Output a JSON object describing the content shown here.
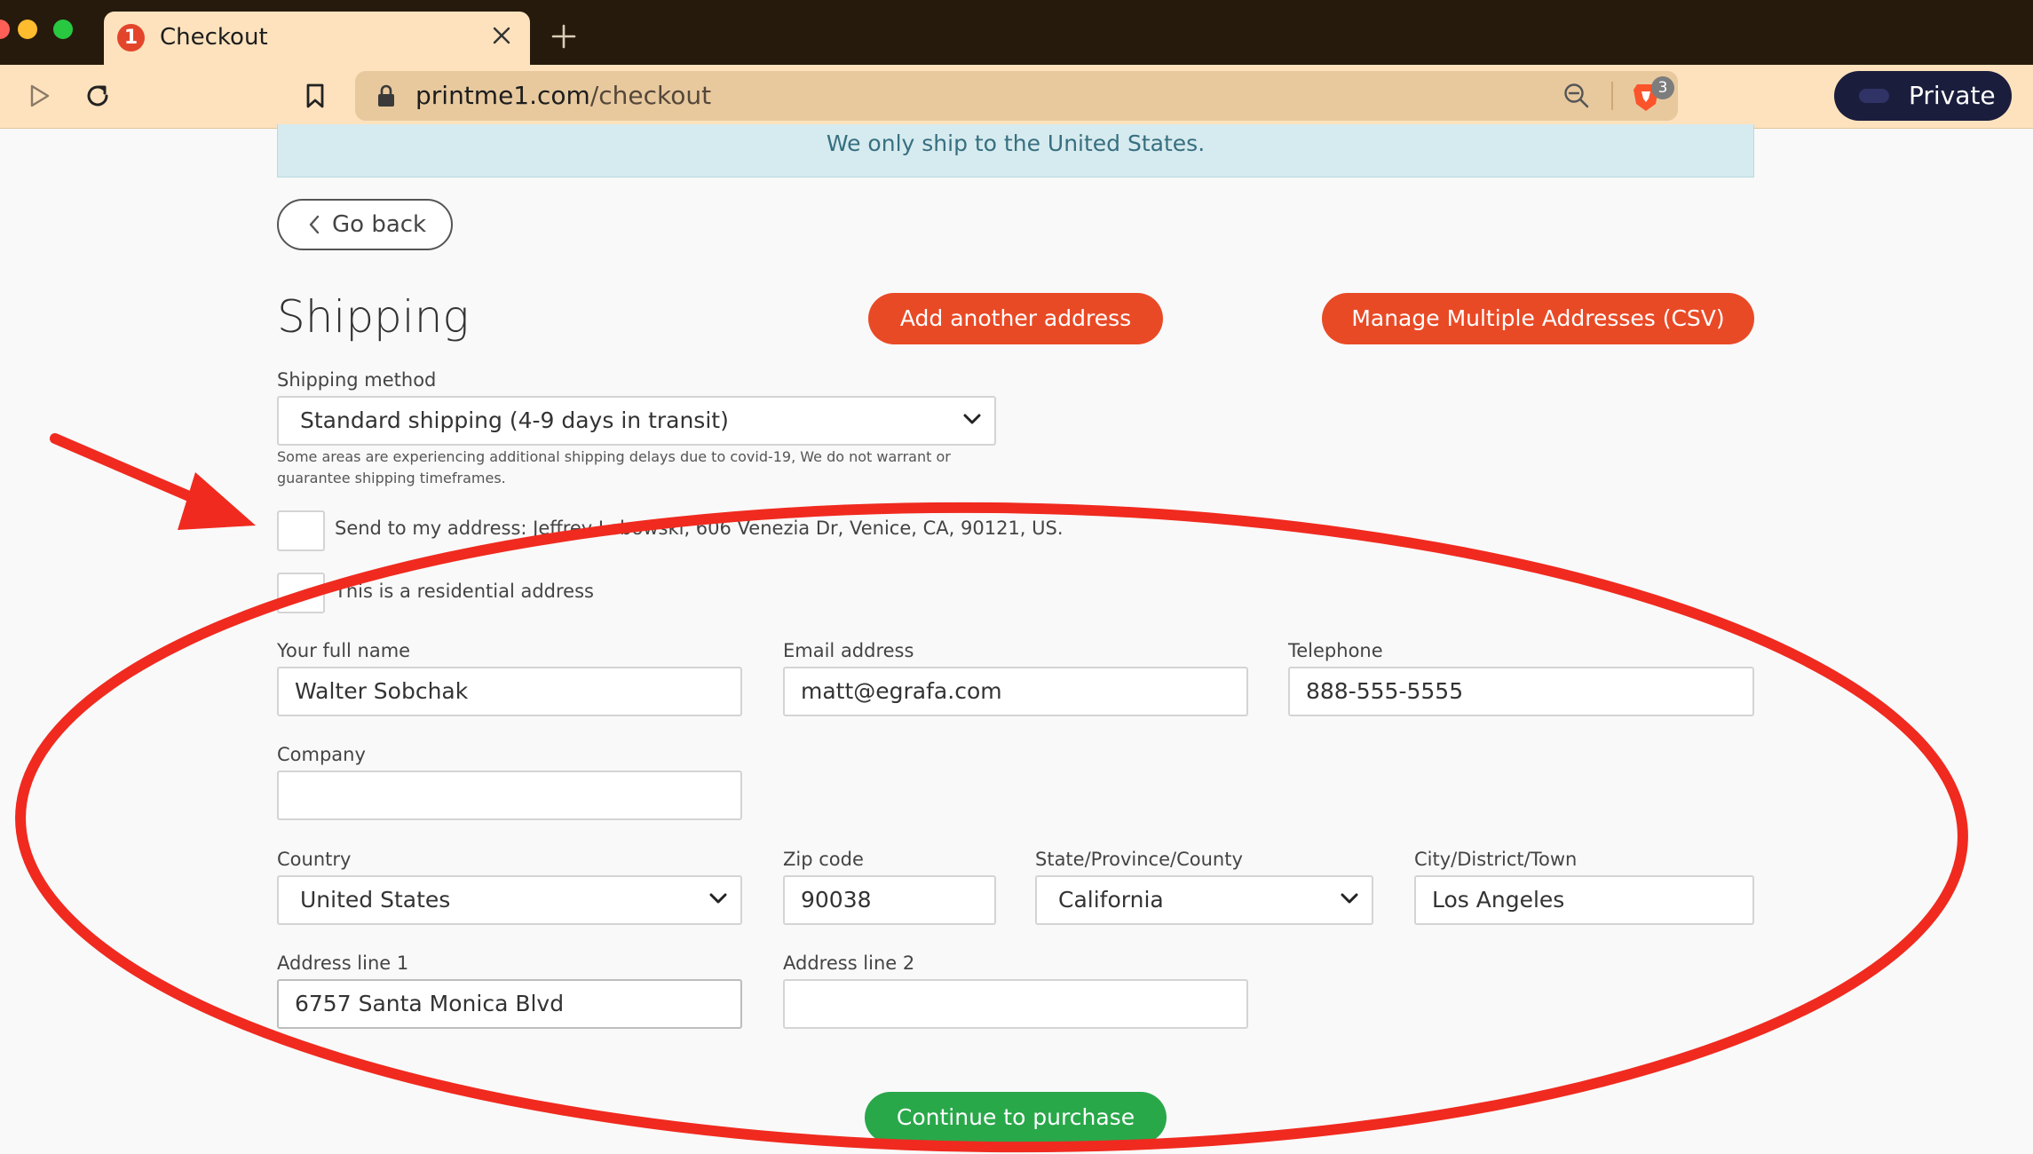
{
  "browser": {
    "tab_title": "Checkout",
    "tab_favicon_text": "1",
    "url_host": "printme1.com",
    "url_path": "/checkout",
    "shields_count": "3",
    "private_label": "Private",
    "icons": [
      "play-icon",
      "reload-icon",
      "bookmark-icon",
      "lock-icon",
      "zoom-out-icon",
      "brave-shield-icon",
      "private-mask-icon",
      "close-icon",
      "plus-icon"
    ]
  },
  "notice": "We only ship to the United States.",
  "go_back_label": "Go back",
  "shipping": {
    "title": "Shipping",
    "add_address_label": "Add another address",
    "manage_multiple_label": "Manage Multiple Addresses (CSV)",
    "method_label": "Shipping method",
    "method_value": "Standard shipping (4-9 days in transit)",
    "delay_note": "Some areas are experiencing additional shipping delays due to covid-19, We do not warrant or guarantee shipping timeframes.",
    "send_to_my_address_label": "Send to my address: Jeffrey Lebowski, 606 Venezia Dr, Venice, CA, 90121, US.",
    "send_to_my_address_checked": false,
    "residential_label": "This is a residential address",
    "residential_checked": true
  },
  "form": {
    "full_name_label": "Your full name",
    "full_name_value": "Walter Sobchak",
    "email_label": "Email address",
    "email_value": "matt@egrafa.com",
    "telephone_label": "Telephone",
    "telephone_value": "888-555-5555",
    "company_label": "Company",
    "company_value": "",
    "country_label": "Country",
    "country_value": "United States",
    "zip_label": "Zip code",
    "zip_value": "90038",
    "state_label": "State/Province/County",
    "state_value": "California",
    "city_label": "City/District/Town",
    "city_value": "Los Angeles",
    "address1_label": "Address line 1",
    "address1_value": "6757 Santa Monica Blvd",
    "address2_label": "Address line 2",
    "address2_value": ""
  },
  "continue_label": "Continue to purchase",
  "annotation": {
    "color": "#f02a1f",
    "shapes": [
      "arrow",
      "ellipse"
    ]
  }
}
